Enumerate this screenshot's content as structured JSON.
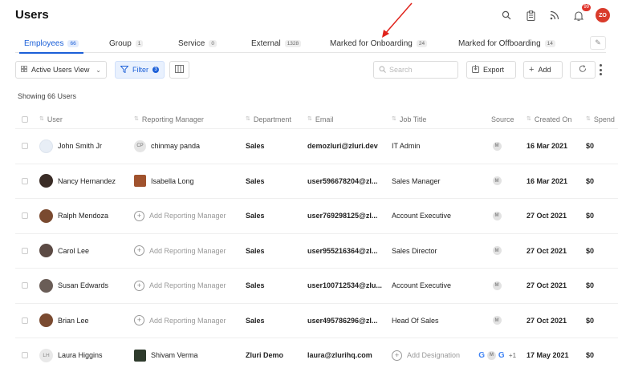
{
  "header": {
    "title": "Users",
    "notification_count": "99",
    "avatar_initials": "ZO"
  },
  "tabs": [
    {
      "label": "Employees",
      "count": "66",
      "active": true
    },
    {
      "label": "Group",
      "count": "1"
    },
    {
      "label": "Service",
      "count": "0"
    },
    {
      "label": "External",
      "count": "1328"
    },
    {
      "label": "Marked for Onboarding",
      "count": "24"
    },
    {
      "label": "Marked for Offboarding",
      "count": "14"
    }
  ],
  "toolbar": {
    "view_label": "Active Users View",
    "filter_label": "Filter",
    "filter_count": "3",
    "search_placeholder": "Search",
    "export_label": "Export",
    "add_label": "Add"
  },
  "showing_text": "Showing 66 Users",
  "columns": [
    "User",
    "Reporting Manager",
    "Department",
    "Email",
    "Job Title",
    "Source",
    "Created On",
    "Spend"
  ],
  "add_manager_label": "Add Reporting Manager",
  "add_designation_label": "Add Designation",
  "rows": [
    {
      "user": "John Smith Jr",
      "avatar": "lt",
      "manager": "chinmay panda",
      "manager_initials": "CP",
      "department": "Sales",
      "email": "demozluri@zluri.dev",
      "job_title": "IT Admin",
      "source": "M",
      "created_on": "16 Mar 2021",
      "spend": "$0"
    },
    {
      "user": "Nancy Hernandez",
      "avatar": "ph",
      "manager": "Isabella Long",
      "manager_img": true,
      "department": "Sales",
      "email": "user596678204@zl...",
      "job_title": "Sales Manager",
      "source": "M",
      "created_on": "16 Mar 2021",
      "spend": "$0"
    },
    {
      "user": "Ralph Mendoza",
      "avatar": "ph2",
      "manager": "",
      "department": "Sales",
      "email": "user769298125@zl...",
      "job_title": "Account Executive",
      "source": "M",
      "created_on": "27 Oct 2021",
      "spend": "$0"
    },
    {
      "user": "Carol Lee",
      "avatar": "ph4",
      "manager": "",
      "department": "Sales",
      "email": "user955216364@zl...",
      "job_title": "Sales Director",
      "source": "M",
      "created_on": "27 Oct 2021",
      "spend": "$0"
    },
    {
      "user": "Susan Edwards",
      "avatar": "ph5",
      "manager": "",
      "department": "Sales",
      "email": "user100712534@zlu...",
      "job_title": "Account Executive",
      "source": "M",
      "created_on": "27 Oct 2021",
      "spend": "$0"
    },
    {
      "user": "Brian Lee",
      "avatar": "ph2",
      "manager": "",
      "department": "Sales",
      "email": "user495786296@zl...",
      "job_title": "Head Of Sales",
      "source": "M",
      "created_on": "27 Oct 2021",
      "spend": "$0"
    },
    {
      "user": "Laura Higgins",
      "avatar": "gray",
      "avatar_initials": "LH",
      "manager": "Shivam Verma",
      "manager_img2": true,
      "department": "Zluri Demo",
      "email": "laura@zlurihq.com",
      "job_title": "",
      "source_multi": true,
      "source_extra": "+1",
      "created_on": "17 May 2021",
      "spend": "$0"
    }
  ]
}
